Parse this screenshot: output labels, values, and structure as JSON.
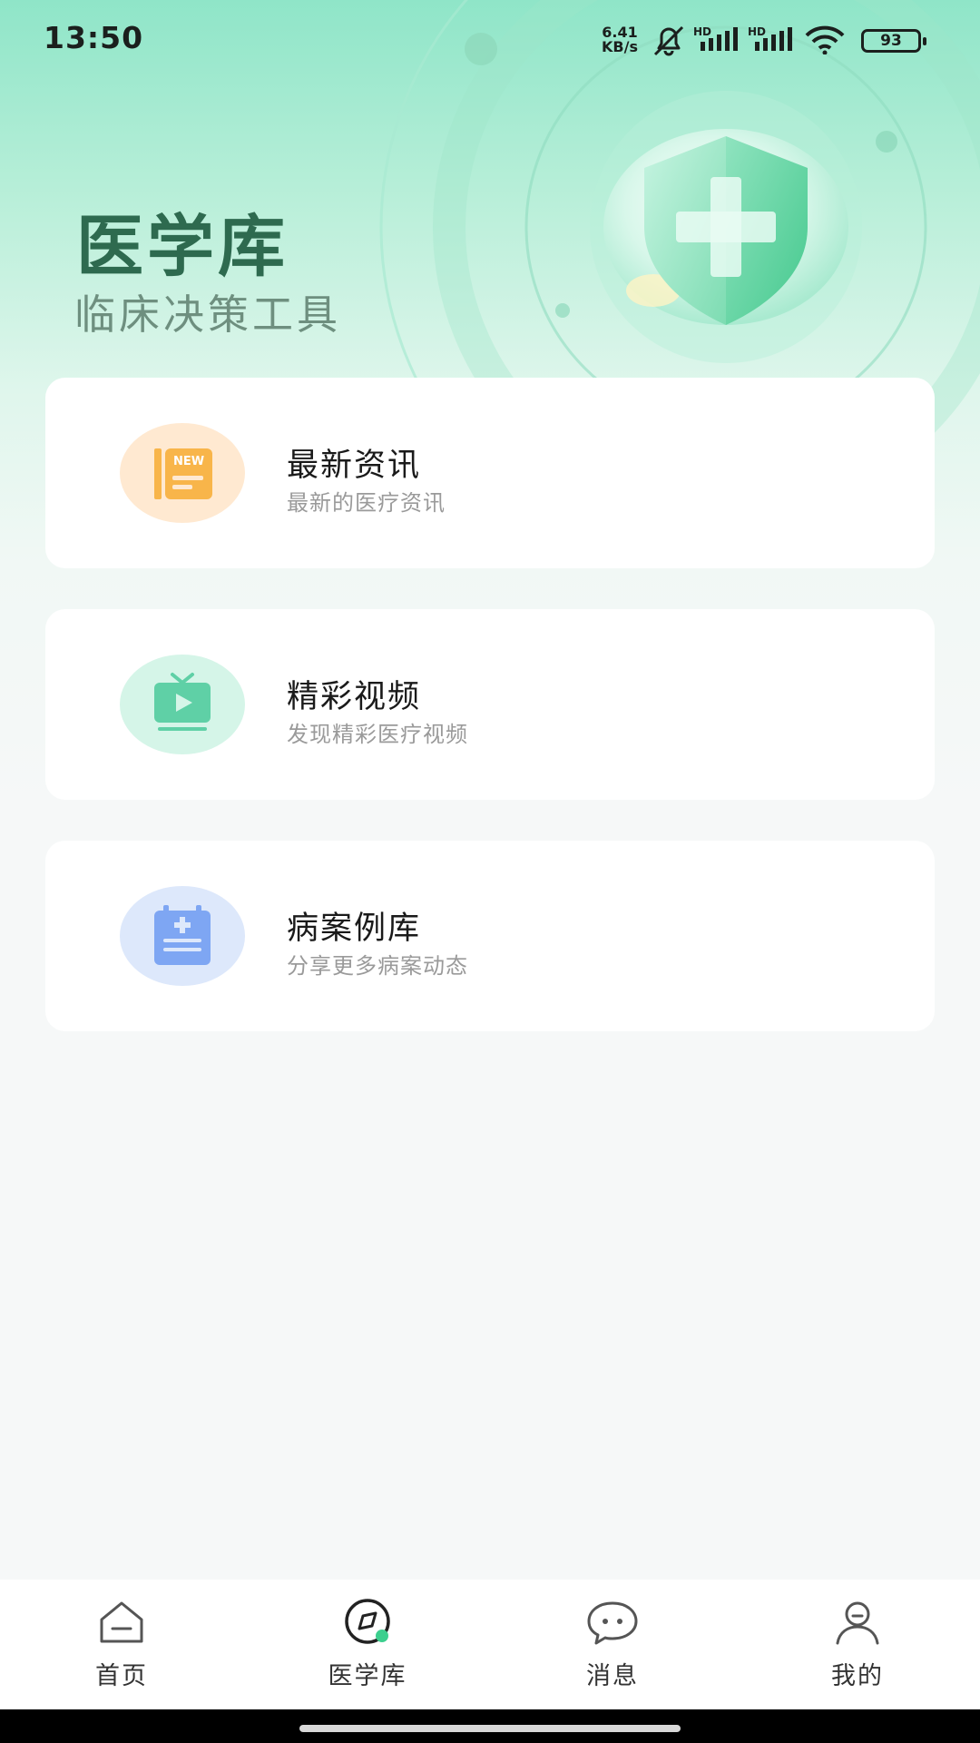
{
  "status_bar": {
    "time": "13:50",
    "net_speed_value": "6.41",
    "net_speed_unit": "KB/s",
    "sim1_label": "HD",
    "sim2_label": "HD",
    "battery": "93"
  },
  "hero": {
    "title": "医学库",
    "subtitle": "临床决策工具"
  },
  "cards": [
    {
      "title": "最新资讯",
      "desc": "最新的医疗资讯",
      "icon": "newspaper-icon",
      "icon_badge": "NEW",
      "bg": "#ffe9d1",
      "fg": "#f8b54a"
    },
    {
      "title": "精彩视频",
      "desc": "发现精彩医疗视频",
      "icon": "tv-icon",
      "bg": "#d5f5e8",
      "fg": "#5fd0a6"
    },
    {
      "title": "病案例库",
      "desc": "分享更多病案动态",
      "icon": "clipboard-icon",
      "bg": "#dde8fb",
      "fg": "#7ea6f3"
    }
  ],
  "tab_bar": {
    "items": [
      {
        "label": "首页",
        "icon": "home-icon"
      },
      {
        "label": "医学库",
        "icon": "compass-icon"
      },
      {
        "label": "消息",
        "icon": "chat-icon"
      },
      {
        "label": "我的",
        "icon": "user-icon"
      }
    ],
    "active_index": 1,
    "accent": "#3ccf8e"
  }
}
